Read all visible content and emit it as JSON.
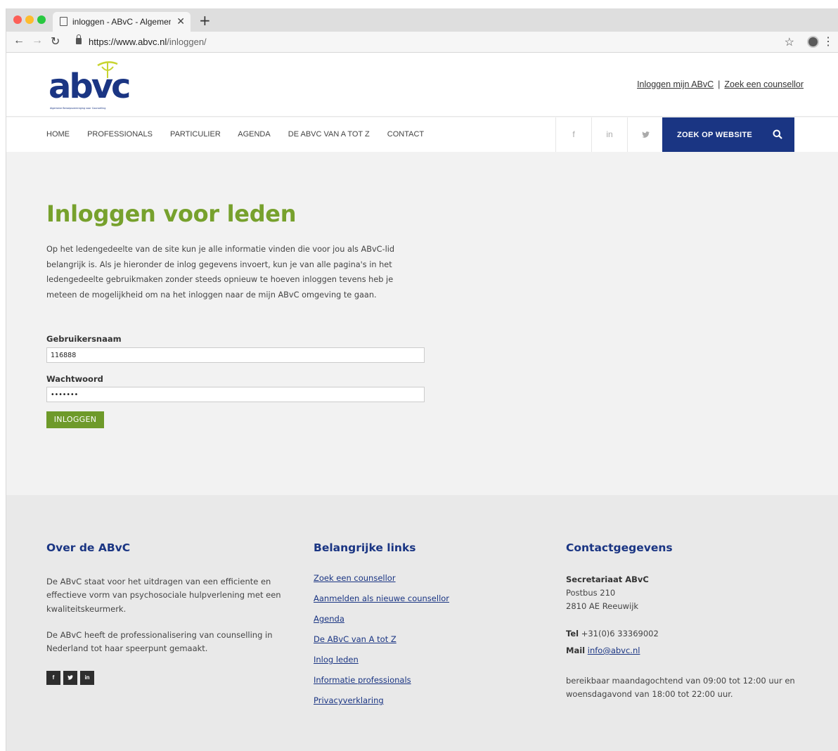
{
  "browser": {
    "tab_title": "inloggen - ABvC - Algemene B",
    "url_host": "https://www.abvc.nl",
    "url_path": "/inloggen/"
  },
  "header": {
    "logo_text": "abvc",
    "logo_tagline": "Algemene Beroepsvereniging voor Counselling",
    "toplinks": [
      "Inloggen mijn ABvC",
      "Zoek een counsellor"
    ],
    "toplinks_sep": "|"
  },
  "nav": {
    "items": [
      "HOME",
      "PROFESSIONALS",
      "PARTICULIER",
      "AGENDA",
      "DE ABVC VAN A TOT Z",
      "CONTACT"
    ],
    "social": [
      "f",
      "in",
      "t"
    ],
    "search_label": "ZOEK OP WEBSITE"
  },
  "main": {
    "title": "Inloggen voor leden",
    "intro": "Op het ledengedeelte van de site kun je alle informatie vinden die voor jou als ABvC-lid belangrijk is. Als je hieronder de inlog gegevens invoert, kun je van alle pagina's in het ledengedeelte gebruikmaken zonder steeds opnieuw te hoeven inloggen tevens heb je meteen de mogelijkheid om na het inloggen naar de mijn ABvC omgeving te gaan.",
    "username_label": "Gebruikersnaam",
    "username_value": "116888",
    "password_label": "Wachtwoord",
    "password_value": "•••••••",
    "login_button": "INLOGGEN"
  },
  "footer": {
    "about": {
      "title": "Over de ABvC",
      "para1": "De ABvC staat voor het uitdragen van een efficiente en effectieve vorm van psychosociale hulpverlening met een kwaliteitskeurmerk.",
      "para2": "De ABvC heeft de professionalisering van counselling in Nederland tot haar speerpunt gemaakt.",
      "social": [
        "f",
        "t",
        "in"
      ]
    },
    "links": {
      "title": "Belangrijke links",
      "items": [
        "Zoek een counsellor",
        "Aanmelden als nieuwe counsellor",
        "Agenda",
        "De ABvC van A tot Z",
        "Inlog leden",
        "Informatie professionals",
        "Privacyverklaring"
      ]
    },
    "contact": {
      "title": "Contactgegevens",
      "org": "Secretariaat ABvC",
      "address1": "Postbus 210",
      "address2": "2810 AE Reeuwijk",
      "tel_label": "Tel",
      "tel_value": "+31(0)6  33369002",
      "mail_label": "Mail",
      "mail_value": "info@abvc.nl",
      "hours": "bereikbaar maandagochtend van 09:00 tot 12:00 uur en woensdagavond van 18:00 tot 22:00 uur."
    }
  },
  "colors": {
    "brand_green": "#77a12d",
    "brand_blue": "#1a3583"
  }
}
